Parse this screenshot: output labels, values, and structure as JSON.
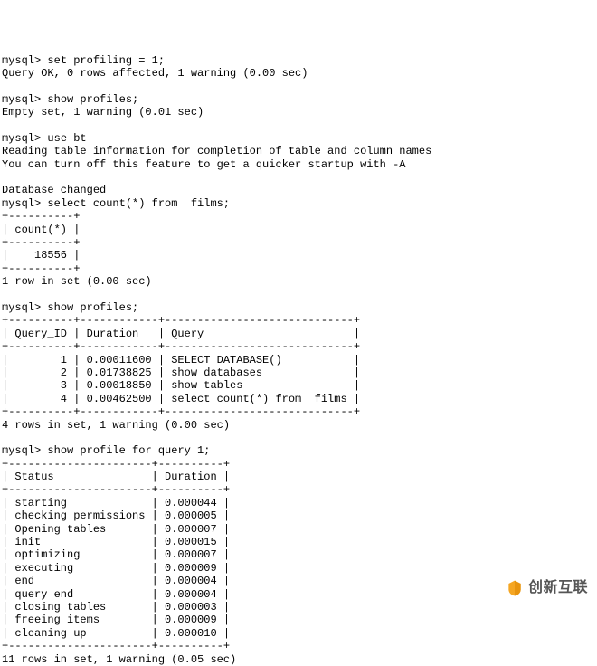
{
  "prompt": "mysql>",
  "cmd1": "set profiling = 1;",
  "res1": "Query OK, 0 rows affected, 1 warning (0.00 sec)",
  "cmd2": "show profiles;",
  "res2": "Empty set, 1 warning (0.01 sec)",
  "cmd3": "use bt",
  "res3a": "Reading table information for completion of table and column names",
  "res3b": "You can turn off this feature to get a quicker startup with -A",
  "res3c": "Database changed",
  "cmd4": "select count(*) from  films;",
  "table1": {
    "border": "+----------+",
    "header": "| count(*) |",
    "row": "|    18556 |",
    "footer": "1 row in set (0.00 sec)"
  },
  "cmd5": "show profiles;",
  "table2": {
    "border": "+----------+------------+-----------------------------+",
    "header": "| Query_ID | Duration   | Query                       |",
    "row1": "|        1 | 0.00011600 | SELECT DATABASE()           |",
    "row2": "|        2 | 0.01738825 | show databases              |",
    "row3": "|        3 | 0.00018850 | show tables                 |",
    "row4": "|        4 | 0.00462500 | select count(*) from  films |",
    "footer": "4 rows in set, 1 warning (0.00 sec)"
  },
  "cmd6": "show profile for query 1;",
  "table3": {
    "border": "+----------------------+----------+",
    "header": "| Status               | Duration |",
    "row1": "| starting             | 0.000044 |",
    "row2": "| checking permissions | 0.000005 |",
    "row3": "| Opening tables       | 0.000007 |",
    "row4": "| init                 | 0.000015 |",
    "row5": "| optimizing           | 0.000007 |",
    "row6": "| executing            | 0.000009 |",
    "row7": "| end                  | 0.000004 |",
    "row8": "| query end            | 0.000004 |",
    "row9": "| closing tables       | 0.000003 |",
    "row10": "| freeing items        | 0.000009 |",
    "row11": "| cleaning up          | 0.000010 |",
    "footer": "11 rows in set, 1 warning (0.05 sec)"
  },
  "watermark": "创新互联"
}
